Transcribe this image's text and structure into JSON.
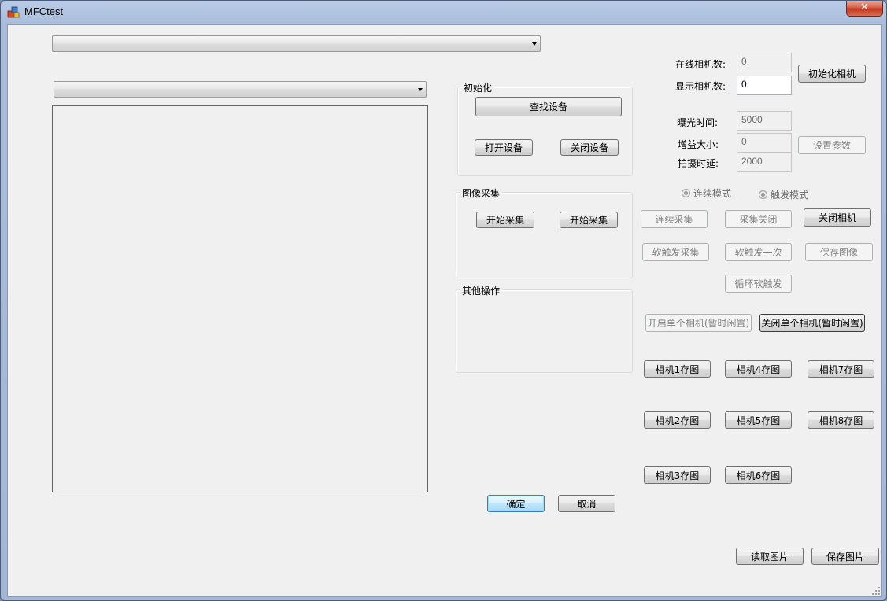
{
  "window": {
    "title": "MFCtest",
    "close_glyph": "✕",
    "app_icon": "mfc-app-icon"
  },
  "top_combo": {
    "value": ""
  },
  "image_combo": {
    "value": ""
  },
  "group_init": {
    "title": "初始化",
    "find_device": "查找设备",
    "open_device": "打开设备",
    "close_device": "关闭设备"
  },
  "group_capture": {
    "title": "图像采集",
    "start_capture_1": "开始采集",
    "start_capture_2": "开始采集"
  },
  "group_other": {
    "title": "其他操作"
  },
  "dialog_buttons": {
    "ok": "确定",
    "cancel": "取消"
  },
  "camera_info": {
    "online_label": "在线相机数:",
    "online_value": "0",
    "display_label": "显示相机数:",
    "display_value": "0",
    "init_camera": "初始化相机"
  },
  "params": {
    "exposure_label": "曝光时间:",
    "exposure_value": "5000",
    "gain_label": "增益大小:",
    "gain_value": "0",
    "delay_label": "拍摄时延:",
    "delay_value": "2000",
    "set_params": "设置参数"
  },
  "modes": {
    "continuous": "连续模式",
    "trigger": "触发模式"
  },
  "acquisition": {
    "continuous_capture": "连续采集",
    "capture_close": "采集关闭",
    "close_camera": "关闭相机",
    "soft_trigger_capture": "软触发采集",
    "soft_trigger_once": "软触发一次",
    "save_image": "保存图像",
    "loop_soft_trigger": "循环软触发",
    "open_single": "开启单个相机(暂时闲置)",
    "close_single": "关闭单个相机(暂时闲置)"
  },
  "camera_save": {
    "cam1": "相机1存图",
    "cam2": "相机2存图",
    "cam3": "相机3存图",
    "cam4": "相机4存图",
    "cam5": "相机5存图",
    "cam6": "相机6存图",
    "cam7": "相机7存图",
    "cam8": "相机8存图"
  },
  "file": {
    "read_picture": "读取图片",
    "save_picture": "保存图片"
  }
}
